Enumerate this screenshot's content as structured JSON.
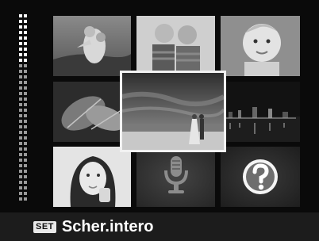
{
  "gallery": {
    "thumbnails": [
      {
        "name": "photo-piggyback-couple",
        "selected": false
      },
      {
        "name": "photo-two-boys",
        "selected": false
      },
      {
        "name": "photo-baby",
        "selected": false
      },
      {
        "name": "photo-leaves",
        "selected": false
      },
      {
        "name": "photo-beach-couple",
        "selected": true
      },
      {
        "name": "photo-night-city",
        "selected": false
      },
      {
        "name": "photo-woman-portrait",
        "selected": false
      },
      {
        "name": "voice-memo-thumbnail",
        "icon": "microphone-icon",
        "selected": false
      },
      {
        "name": "help-thumbnail",
        "icon": "question-mark-icon",
        "selected": false
      }
    ],
    "scrollbar_icon": "dotted-scrollbar"
  },
  "footer": {
    "button": "SET",
    "label": "Scher.intero"
  }
}
